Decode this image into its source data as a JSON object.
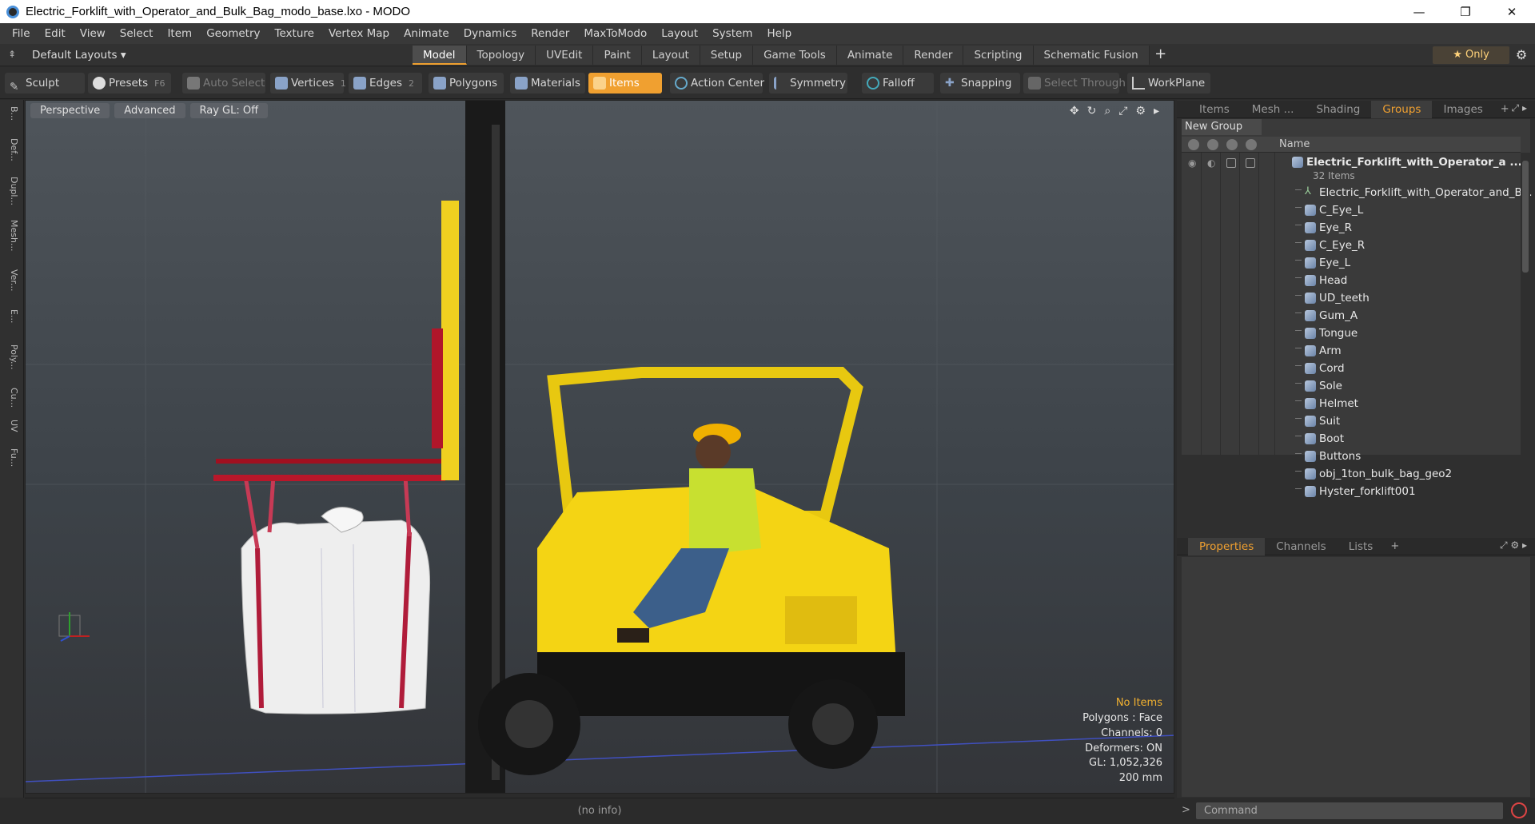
{
  "window": {
    "title": "Electric_Forklift_with_Operator_and_Bulk_Bag_modo_base.lxo - MODO",
    "minimize": "—",
    "restore": "❐",
    "close": "✕"
  },
  "menu": [
    "File",
    "Edit",
    "View",
    "Select",
    "Item",
    "Geometry",
    "Texture",
    "Vertex Map",
    "Animate",
    "Dynamics",
    "Render",
    "MaxToModo",
    "Layout",
    "System",
    "Help"
  ],
  "layoutbar": {
    "layout_dropdown": "Default Layouts ▾",
    "tabs": [
      "Model",
      "Topology",
      "UVEdit",
      "Paint",
      "Layout",
      "Setup",
      "Game Tools",
      "Animate",
      "Render",
      "Scripting",
      "Schematic Fusion"
    ],
    "active_tab": "Model",
    "add": "+",
    "only": "★  Only"
  },
  "toolbar": {
    "sculpt": "Sculpt",
    "presets": "Presets",
    "presets_key": "F6",
    "auto_select": "Auto Select",
    "vertices": "Vertices",
    "vertices_count": "1",
    "edges": "Edges",
    "edges_count": "2",
    "polygons": "Polygons",
    "materials": "Materials",
    "items": "Items",
    "action_center": "Action Center",
    "symmetry": "Symmetry",
    "falloff": "Falloff",
    "snapping": "Snapping",
    "select_through": "Select Through",
    "workplane": "WorkPlane"
  },
  "leftstrip": [
    "B...",
    "Def...",
    "Dupl...",
    "Mesh...",
    "Ver...",
    "E...",
    "Poly...",
    "Cu...",
    "UV",
    "Fu..."
  ],
  "viewport": {
    "perspective": "Perspective",
    "advanced": "Advanced",
    "raygl": "Ray GL: Off",
    "info": {
      "no_items": "No Items",
      "polygons": "Polygons : Face",
      "channels": "Channels: 0",
      "deformers": "Deformers: ON",
      "gl": "GL: 1,052,326",
      "scale": "200 mm"
    }
  },
  "status": "(no info)",
  "right_tabs": [
    "Items",
    "Mesh ...",
    "Shading",
    "Groups",
    "Images"
  ],
  "right_active": "Groups",
  "groups": {
    "new_group": "New Group",
    "column_name": "Name",
    "root_name": "Electric_Forklift_with_Operator_a ...",
    "root_count": "32 Items",
    "items": [
      "Electric_Forklift_with_Operator_and_B...",
      "C_Eye_L",
      "Eye_R",
      "C_Eye_R",
      "Eye_L",
      "Head",
      "UD_teeth",
      "Gum_A",
      "Tongue",
      "Arm",
      "Cord",
      "Sole",
      "Helmet",
      "Suit",
      "Boot",
      "Buttons",
      "obj_1ton_bulk_bag_geo2",
      "Hyster_forklift001"
    ]
  },
  "bottom_tabs": [
    "Properties",
    "Channels",
    "Lists"
  ],
  "bottom_active": "Properties",
  "command_placeholder": "Command"
}
